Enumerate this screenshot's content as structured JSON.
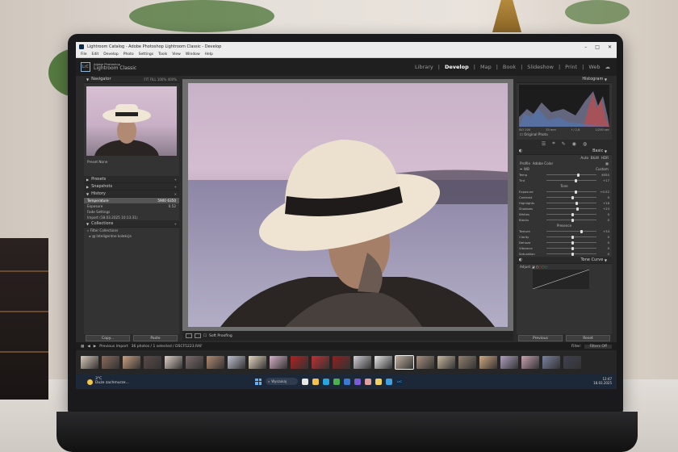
{
  "window": {
    "title": "Lightroom Catalog - Adobe Photoshop Lightroom Classic - Develop",
    "controls": [
      "–",
      "□",
      "✕"
    ]
  },
  "menu": [
    "File",
    "Edit",
    "Develop",
    "Photo",
    "Settings",
    "Tools",
    "View",
    "Window",
    "Help"
  ],
  "header": {
    "logo": "LrC",
    "brand_line1": "Adobe Photoshop",
    "brand_line2": "Lightroom Classic",
    "modules": [
      "Library",
      "Develop",
      "Map",
      "Book",
      "Slideshow",
      "Print",
      "Web"
    ],
    "active_module": "Develop"
  },
  "left_panel": {
    "navigator": {
      "title": "Navigator",
      "zoom": [
        "FIT",
        "FILL",
        "100%",
        "400%"
      ]
    },
    "preset_row": {
      "label": "Preset",
      "value": "None"
    },
    "sections": {
      "presets": "Presets",
      "snapshots": "Snapshots",
      "history": "History",
      "collections": "Collections"
    },
    "history_items": [
      {
        "label": "Temperature",
        "v1": "5900",
        "v2": "6350"
      },
      {
        "label": "Exposure",
        "v1": "",
        "v2": "0.52"
      },
      {
        "label": "Fade Settings",
        "v1": "",
        "v2": ""
      },
      {
        "label": "Import (18.03.2025 10:13:31)",
        "v1": "",
        "v2": ""
      }
    ],
    "collection_items": [
      "Filter Collections",
      "Inteligentne kolekcje"
    ],
    "copy_btn": "Copy...",
    "paste_btn": "Paste"
  },
  "toolbar": {
    "soft_proofing": "Soft Proofing"
  },
  "right_panel": {
    "histogram_title": "Histogram",
    "hist_info": [
      "ISO 200",
      "33 mm",
      "f / 2,8",
      "1/250 sec"
    ],
    "original_photo": "Original Photo",
    "basic_title": "Basic",
    "treatment": [
      "Auto",
      "B&W",
      "HDR"
    ],
    "profile": {
      "label": "Profile",
      "value": "Adobe Color"
    },
    "wb": {
      "label": "WB",
      "value": "Custom"
    },
    "tone_label": "Tone",
    "presence_label": "Presence",
    "sliders": [
      {
        "label": "Temp",
        "value": "6350",
        "pos": 0.62
      },
      {
        "label": "Tint",
        "value": "+17",
        "pos": 0.56
      },
      {
        "label": "Exposure",
        "value": "+0.52",
        "pos": 0.56
      },
      {
        "label": "Contrast",
        "value": "0",
        "pos": 0.5
      },
      {
        "label": "Highlights",
        "value": "+16",
        "pos": 0.58
      },
      {
        "label": "Shadows",
        "value": "+23",
        "pos": 0.6
      },
      {
        "label": "Whites",
        "value": "0",
        "pos": 0.5
      },
      {
        "label": "Blacks",
        "value": "0",
        "pos": 0.5
      },
      {
        "label": "Texture",
        "value": "+34",
        "pos": 0.67
      },
      {
        "label": "Clarity",
        "value": "0",
        "pos": 0.5
      },
      {
        "label": "Dehaze",
        "value": "0",
        "pos": 0.5
      },
      {
        "label": "Vibrance",
        "value": "0",
        "pos": 0.5
      },
      {
        "label": "Saturation",
        "value": "0",
        "pos": 0.5
      }
    ],
    "tone_curve_title": "Tone Curve",
    "adjust_label": "Adjust",
    "previous_btn": "Previous",
    "reset_btn": "Reset"
  },
  "filmstrip": {
    "source": "Previous Import",
    "count": "36 photos / 1 selected / DSCF5223.RAF",
    "filter_label": "Filter:",
    "filter_value": "Filters Off"
  },
  "taskbar": {
    "weather_temp": "3°C",
    "weather_desc": "Duże zachmurze...",
    "search_placeholder": "Wyszukaj",
    "time": "12:47",
    "date": "18.03.2025"
  }
}
